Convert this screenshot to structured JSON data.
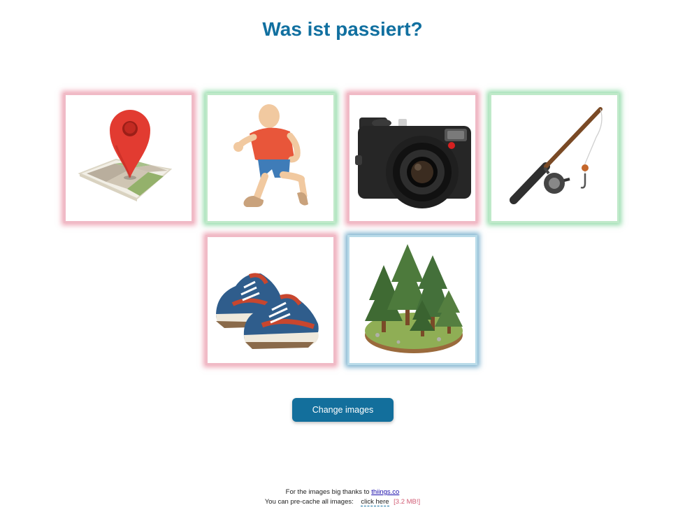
{
  "page": {
    "title": "Was ist passiert?"
  },
  "cards": [
    {
      "icon": "map-pin-icon",
      "state": "red"
    },
    {
      "icon": "runner-icon",
      "state": "green"
    },
    {
      "icon": "camera-icon",
      "state": "red"
    },
    {
      "icon": "fishing-rod-icon",
      "state": "green"
    },
    {
      "icon": "sneakers-icon",
      "state": "red"
    },
    {
      "icon": "forest-icon",
      "state": "blue"
    }
  ],
  "colors": {
    "title": "#1170a0",
    "button": "#136f9c",
    "red_glow": "#e0607c",
    "green_glow": "#3cbe64",
    "blue_glow": "#1e78aa"
  },
  "button": {
    "change_label": "Change images"
  },
  "footer": {
    "thanks_text": "For the images big thanks to",
    "thanks_link": "thiings.co",
    "precache_text": "You can pre-cache all images:",
    "precache_link": "click here",
    "size_note": "[3.2 MB!]"
  }
}
